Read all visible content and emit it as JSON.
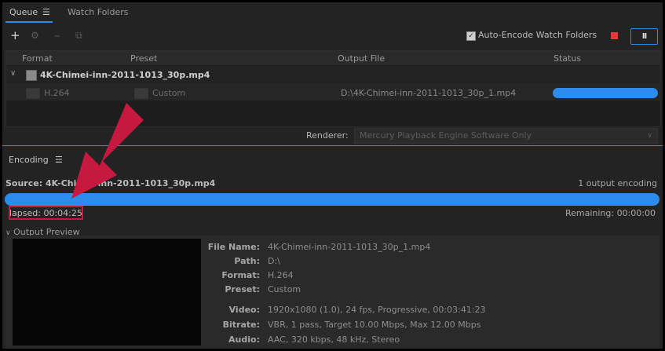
{
  "tabs": [
    {
      "label": "Queue",
      "active": true
    },
    {
      "label": "Watch Folders",
      "active": false
    }
  ],
  "toolbar": {
    "auto_encode_label": "Auto-Encode Watch Folders",
    "auto_encode_checked": true,
    "pause_label": "II"
  },
  "queue": {
    "columns": [
      "Format",
      "Preset",
      "Output File",
      "Status"
    ],
    "item": {
      "filename": "4K-Chimei-inn-2011-1013_30p.mp4",
      "format": "H.264",
      "preset": "Custom",
      "output_file": "D:\\4K-Chimei-inn-2011-1013_30p_1.mp4",
      "status_progress": 1.0
    }
  },
  "renderer": {
    "label": "Renderer:",
    "value": "Mercury Playback Engine Software Only"
  },
  "encoding": {
    "title": "Encoding",
    "source": "Source: 4K-Chimei-inn-2011-1013_30p.mp4",
    "outputs": "1 output encoding",
    "progress": 1.0,
    "elapsed": "lapsed: 00:04:25",
    "remaining": "Remaining: 00:00:00"
  },
  "output_preview": {
    "title": "Output Preview",
    "info": [
      {
        "label": "File Name:",
        "value": "4K-Chimei-inn-2011-1013_30p_1.mp4"
      },
      {
        "label": "Path:",
        "value": "D:\\"
      },
      {
        "label": "Format:",
        "value": "H.264"
      },
      {
        "label": "Preset:",
        "value": "Custom"
      },
      {
        "label": "Video:",
        "value": "1920x1080 (1.0), 24 fps, Progressive, 00:03:41:23"
      },
      {
        "label": "Bitrate:",
        "value": "VBR, 1 pass, Target 10.00 Mbps, Max 12.00 Mbps"
      },
      {
        "label": "Audio:",
        "value": "AAC, 320 kbps, 48 kHz, Stereo"
      }
    ]
  },
  "colors": {
    "accent": "#2d8ceb",
    "stop": "#e23a3a",
    "annotation": "#c6193f"
  }
}
